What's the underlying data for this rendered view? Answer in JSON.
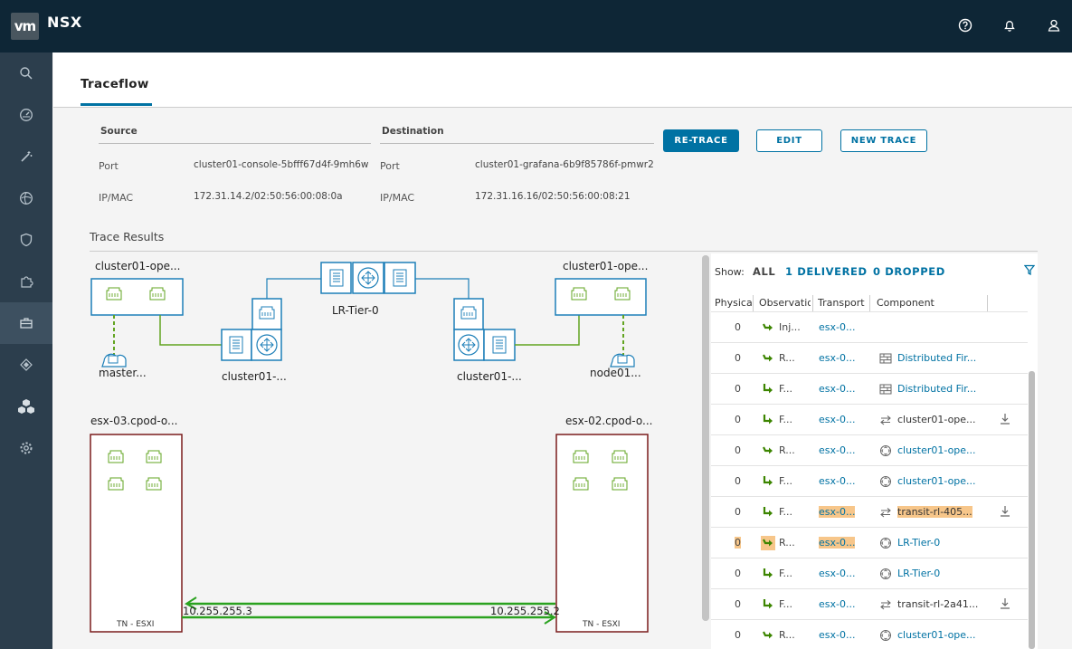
{
  "app": {
    "logo": "vm",
    "name": "NSX"
  },
  "topbar_icons": [
    "help-icon",
    "bell-icon",
    "user-icon"
  ],
  "sidebar_icons": [
    "search-icon",
    "dashboard-icon",
    "wand-icon",
    "network-icon",
    "shield-icon",
    "puzzle-icon",
    "toolbox-icon",
    "diamond-icon",
    "cubes-icon",
    "settings-icon"
  ],
  "page": {
    "title": "Traceflow"
  },
  "source": {
    "header": "Source",
    "port_label": "Port",
    "port_value": "cluster01-console-5bfff67d4f-9mh6w",
    "ip_label": "IP/MAC",
    "ip_value": "172.31.14.2/02:50:56:00:08:0a"
  },
  "destination": {
    "header": "Destination",
    "port_label": "Port",
    "port_value": "cluster01-grafana-6b9f85786f-pmwr2",
    "ip_label": "IP/MAC",
    "ip_value": "172.31.16.16/02:50:56:00:08:21"
  },
  "buttons": {
    "retrace": "RE-TRACE",
    "edit": "EDIT",
    "new_trace": "NEW TRACE"
  },
  "results": {
    "title": "Trace Results"
  },
  "diagram": {
    "left_top": "cluster01-ope...",
    "right_top": "cluster01-ope...",
    "router_center": "LR-Tier-0",
    "left_router": "cluster01-...",
    "right_router": "cluster01-...",
    "left_vm": "master...",
    "right_vm": "node01...",
    "host_left": "esx-03.cpod-o...",
    "host_right": "esx-02.cpod-o...",
    "tn_left": "TN - ESXI",
    "tn_right": "TN - ESXI",
    "ip_left": "10.255.255.3",
    "ip_right": "10.255.255.2"
  },
  "observations": {
    "show_label": "Show:",
    "filter_all": "ALL",
    "filter_delivered": "1 DELIVERED",
    "filter_dropped": "0 DROPPED",
    "columns": [
      "Physica",
      "Observatio",
      "Transport",
      "Component"
    ],
    "colors": {
      "accent": "#0072a3",
      "green": "#3c8500",
      "highlight": "#f7c68a"
    },
    "rows": [
      {
        "physical": "0",
        "obs": "Inj...",
        "transport": "esx-0...",
        "component": "",
        "comp_icon": "",
        "download": false,
        "hl": false
      },
      {
        "physical": "0",
        "obs": "R...",
        "transport": "esx-0...",
        "component": "Distributed Fir...",
        "comp_icon": "firewall-icon",
        "download": false,
        "hl": false
      },
      {
        "physical": "0",
        "obs": "F...",
        "transport": "esx-0...",
        "component": "Distributed Fir...",
        "comp_icon": "firewall-icon",
        "download": false,
        "hl": false
      },
      {
        "physical": "0",
        "obs": "F...",
        "transport": "esx-0...",
        "component": "cluster01-ope...",
        "comp_icon": "switch-icon",
        "download": true,
        "hl": false
      },
      {
        "physical": "0",
        "obs": "R...",
        "transport": "esx-0...",
        "component": "cluster01-ope...",
        "comp_icon": "router-icon",
        "download": false,
        "hl": false
      },
      {
        "physical": "0",
        "obs": "F...",
        "transport": "esx-0...",
        "component": "cluster01-ope...",
        "comp_icon": "router-icon",
        "download": false,
        "hl": false
      },
      {
        "physical": "0",
        "obs": "F...",
        "transport": "esx-0...",
        "component": "transit-rl-405...",
        "comp_icon": "switch-icon",
        "download": true,
        "hl": true
      },
      {
        "physical": "0",
        "obs": "R...",
        "transport": "esx-0...",
        "component": "LR-Tier-0",
        "comp_icon": "router-icon",
        "download": false,
        "hl": true
      },
      {
        "physical": "0",
        "obs": "F...",
        "transport": "esx-0...",
        "component": "LR-Tier-0",
        "comp_icon": "router-icon",
        "download": false,
        "hl": false
      },
      {
        "physical": "0",
        "obs": "F...",
        "transport": "esx-0...",
        "component": "transit-rl-2a41...",
        "comp_icon": "switch-icon",
        "download": true,
        "hl": false
      },
      {
        "physical": "0",
        "obs": "R...",
        "transport": "esx-0...",
        "component": "cluster01-ope...",
        "comp_icon": "router-icon",
        "download": false,
        "hl": false
      }
    ]
  }
}
